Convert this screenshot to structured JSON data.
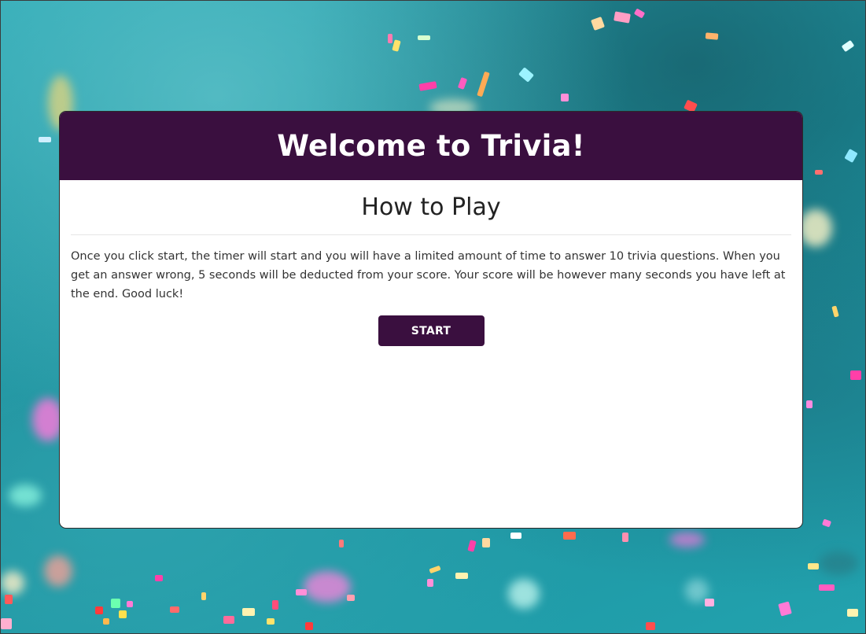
{
  "header": {
    "title": "Welcome to Trivia!"
  },
  "main": {
    "heading": "How to Play",
    "instructions": "Once you click start, the timer will start and you will have a limited amount of time to answer 10 trivia questions. When you get an answer wrong, 5 seconds will be deducted from your score. Your score will be however many seconds you have left at the end. Good luck!",
    "start_label": "START"
  },
  "theme": {
    "header_color": "#3a0f3f",
    "button_color": "#3a0f3f",
    "background_color": "#1e9aa6"
  }
}
